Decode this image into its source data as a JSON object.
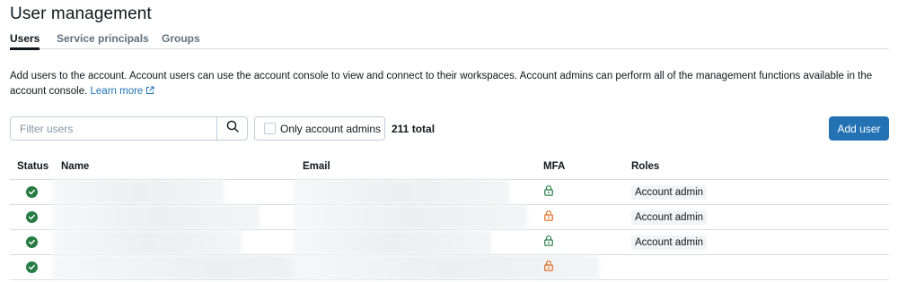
{
  "page": {
    "title": "User management"
  },
  "tabs": [
    {
      "label": "Users",
      "active": true
    },
    {
      "label": "Service principals",
      "active": false
    },
    {
      "label": "Groups",
      "active": false
    }
  ],
  "description": {
    "text": "Add users to the account. Account users can use the account console to view and connect to their workspaces. Account admins can perform all of the management functions available in the account console.",
    "link_label": "Learn more",
    "link_icon": "external-link-icon"
  },
  "toolbar": {
    "filter_placeholder": "Filter users",
    "filter_value": "",
    "search_icon": "search-icon",
    "admin_filter_label": "Only account admins",
    "admin_filter_checked": false,
    "total_label": "211 total",
    "add_label": "Add user"
  },
  "colors": {
    "primary": "#2272b4",
    "status_active": "#277c43",
    "mfa_enabled": "#277c43",
    "mfa_disabled": "#e0661b"
  },
  "table": {
    "columns": [
      "Status",
      "Name",
      "Email",
      "MFA",
      "Roles"
    ],
    "rows": [
      {
        "status": "active",
        "mfa": "enabled",
        "role": "Account admin"
      },
      {
        "status": "active",
        "mfa": "disabled",
        "role": "Account admin"
      },
      {
        "status": "active",
        "mfa": "enabled",
        "role": "Account admin"
      },
      {
        "status": "active",
        "mfa": "disabled",
        "role": ""
      }
    ]
  }
}
